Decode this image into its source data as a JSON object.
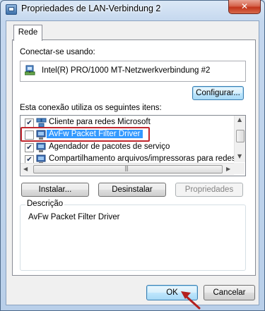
{
  "window": {
    "title": "Propriedades de LAN-Verbindung 2",
    "close_glyph": "✕"
  },
  "tabs": [
    {
      "label": "Rede",
      "selected": true
    }
  ],
  "connect_using": {
    "label": "Conectar-se usando:",
    "adapter": "Intel(R) PRO/1000 MT-Netzwerkverbindung #2",
    "adapter_icon": "network-adapter-icon"
  },
  "buttons": {
    "configure": "Configurar...",
    "install": "Instalar...",
    "uninstall": "Desinstalar",
    "properties": "Propriedades",
    "ok": "OK",
    "cancel": "Cancelar"
  },
  "items_label": "Esta conexão utiliza os seguintes itens:",
  "items": [
    {
      "label": "Cliente para redes Microsoft",
      "checked": true,
      "icon": "network-client-icon",
      "selected": false
    },
    {
      "label": "AvFw Packet Filter Driver",
      "checked": false,
      "icon": "network-service-icon",
      "selected": true
    },
    {
      "label": "Agendador de pacotes de serviço",
      "checked": true,
      "icon": "network-service-icon",
      "selected": false
    },
    {
      "label": "Compartilhamento arquivos/impressoras para redes Mic",
      "checked": true,
      "icon": "network-service-icon",
      "selected": false
    }
  ],
  "description": {
    "title": "Descrição",
    "text": "AvFw Packet Filter Driver"
  },
  "colors": {
    "selection": "#3399ff",
    "highlight_box": "#c0262d",
    "annotation_arrow": "#b3201e"
  }
}
